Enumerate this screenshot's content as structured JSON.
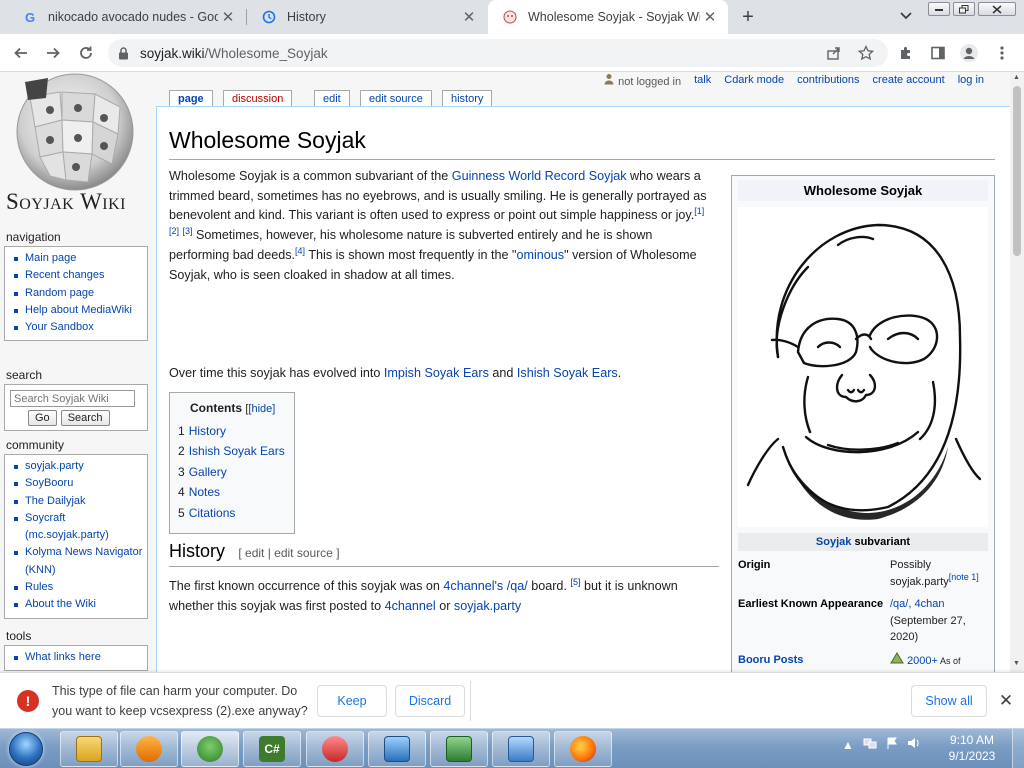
{
  "browser": {
    "tabs": [
      {
        "title": "nikocado avocado nudes - Goog",
        "favicon": "google-icon"
      },
      {
        "title": "History",
        "favicon": "history-icon"
      },
      {
        "title": "Wholesome Soyjak - Soyjak Wiki",
        "favicon": "soyjak-icon"
      }
    ],
    "active_tab": 2,
    "url_host": "soyjak.wiki",
    "url_path": "/Wholesome_Soyjak"
  },
  "wiki": {
    "site_name": "Soyjak Wiki",
    "personal_tools": [
      "not logged in",
      "talk",
      "Cdark mode",
      "contributions",
      "create account",
      "log in"
    ],
    "page_tabs": {
      "page": "page",
      "discussion": "discussion",
      "edit": "edit",
      "edit_source": "edit source",
      "history": "history"
    },
    "navigation": {
      "heading": "navigation",
      "items": [
        "Main page",
        "Recent changes",
        "Random page",
        "Help about MediaWiki",
        "Your Sandbox"
      ]
    },
    "search": {
      "heading": "search",
      "placeholder": "Search Soyjak Wiki",
      "go": "Go",
      "search": "Search"
    },
    "community": {
      "heading": "community",
      "items": [
        "soyjak.party",
        "SoyBooru",
        "The Dailyjak",
        "Soycraft (mc.soyjak.party)",
        "Kolyma News Navigator (KNN)",
        "Rules",
        "About the Wiki"
      ]
    },
    "tools": {
      "heading": "tools",
      "items": [
        "What links here"
      ]
    },
    "title": "Wholesome Soyjak",
    "intro": {
      "p1_a": "Wholesome Soyjak is a common subvariant of the ",
      "p1_link": "Guinness World Record Soyjak",
      "p1_b": " who wears a trimmed beard, sometimes has no eyebrows, and is usually smiling. He is generally portrayed as benevolent and kind. This variant is often used to express or point out simple happiness or joy.",
      "ref1": "[1]",
      "ref2": "[2]",
      "ref3": "[3]",
      "p1_c": " Sometimes, however, his wholesome nature is subverted entirely and he is shown performing bad deeds.",
      "ref4": "[4]",
      "p1_d": " This is shown most frequently in the \"",
      "p1_link2": "ominous",
      "p1_e": "\" version of Wholesome Soyjak, who is seen cloaked in shadow at all times.",
      "p2_a": "Over time this soyjak has evolved into ",
      "p2_link1": "Impish Soyak Ears",
      "p2_b": " and ",
      "p2_link2": "Ishish Soyak Ears",
      "p2_c": "."
    },
    "toc": {
      "title": "Contents",
      "hide": "[hide]",
      "items": [
        {
          "num": "1",
          "text": "History"
        },
        {
          "num": "2",
          "text": "Ishish Soyak Ears"
        },
        {
          "num": "3",
          "text": "Gallery"
        },
        {
          "num": "4",
          "text": "Notes"
        },
        {
          "num": "5",
          "text": "Citations"
        }
      ]
    },
    "history": {
      "heading": "History",
      "edit_links": "[ edit | edit source ]",
      "p_a": "The first known occurrence of this soyjak was on ",
      "p_link1": "4channel's /qa/",
      "p_b": " board. ",
      "ref5": "[5]",
      "p_c": " but it is unknown whether this soyjak was first posted to ",
      "p_link2": "4channel",
      "p_d": " or ",
      "p_link3": "soyjak.party"
    },
    "infobox": {
      "title": "Wholesome Soyjak",
      "caption_link": "Soyjak",
      "caption_rest": " subvariant",
      "rows": [
        {
          "label": "Origin",
          "value": "Possibly soyjak.party",
          "note": "[note 1]"
        },
        {
          "label": "Earliest Known Appearance",
          "value_link": "/qa/, 4chan",
          "value_rest": "(September 27, 2020)"
        },
        {
          "label": "Booru Posts",
          "value_link": "2000+",
          "value_rest": " As of"
        }
      ]
    }
  },
  "download": {
    "message": "This type of file can harm your computer. Do you want to keep vcsexpress (2).exe anyway?",
    "keep": "Keep",
    "discard": "Discard",
    "show_all": "Show all"
  },
  "taskbar": {
    "apps": [
      "explorer-icon",
      "media-player-icon",
      "soyjak-app-icon",
      "csharp-icon",
      "scissors-icon",
      "image-viewer-icon",
      "system-monitor-icon",
      "control-panel-icon",
      "firefox-icon"
    ],
    "time": "9:10 AM",
    "date": "9/1/2023"
  },
  "colors": {
    "link": "#0645ad",
    "redlink": "#ba0000",
    "chrome_bg": "#dee1e6",
    "warn": "#d93025"
  }
}
